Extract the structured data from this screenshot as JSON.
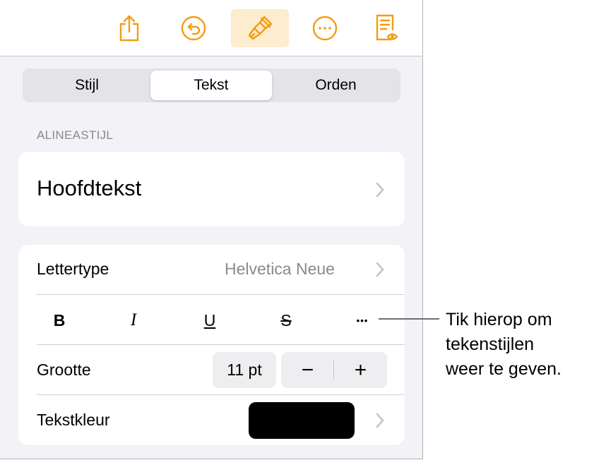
{
  "toolbar": {
    "items": [
      {
        "icon": "share-icon"
      },
      {
        "icon": "undo-icon"
      },
      {
        "icon": "format-brush-icon",
        "active": true
      },
      {
        "icon": "more-icon"
      },
      {
        "icon": "reading-view-icon"
      }
    ],
    "accent_color": "#f39c12"
  },
  "tabs": [
    {
      "label": "Stijl",
      "selected": false
    },
    {
      "label": "Tekst",
      "selected": true
    },
    {
      "label": "Orden",
      "selected": false
    }
  ],
  "paragraph_style": {
    "header": "ALINEASTIJL",
    "value": "Hoofdtekst"
  },
  "font": {
    "label": "Lettertype",
    "value": "Helvetica Neue"
  },
  "text_format": {
    "bold": "B",
    "italic": "I",
    "underline": "U",
    "strikethrough": "S",
    "more": "•••"
  },
  "size": {
    "label": "Grootte",
    "value": "11 pt",
    "decrement": "−",
    "increment": "+"
  },
  "text_color": {
    "label": "Tekstkleur",
    "color": "#000000"
  },
  "callout": {
    "lines": [
      "Tik hierop om",
      "tekenstijlen",
      "weer te geven."
    ]
  }
}
